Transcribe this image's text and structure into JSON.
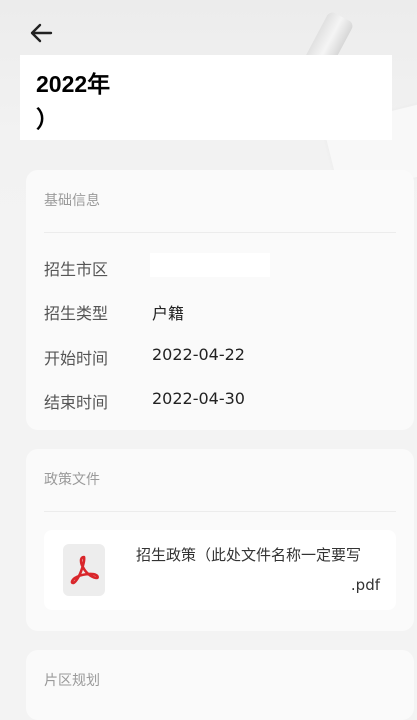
{
  "header": {
    "back_label": "",
    "title_line1": "2022年",
    "title_line2": "）"
  },
  "basic_info": {
    "section_title": "基础信息",
    "rows": [
      {
        "label": "招生市区",
        "value": ""
      },
      {
        "label": "招生类型",
        "value": "户籍"
      },
      {
        "label": "开始时间",
        "value": "2022-04-22"
      },
      {
        "label": "结束时间",
        "value": "2022-04-30"
      }
    ]
  },
  "policy": {
    "section_title": "政策文件",
    "file": {
      "icon": "pdf-icon",
      "name": "招生政策（此处文件名称一定要写",
      "extension": ".pdf"
    }
  },
  "district": {
    "section_title": "片区规划"
  },
  "colors": {
    "pdf_red": "#d9262b",
    "background": "#f3f3f3",
    "card": "#fafafa"
  }
}
